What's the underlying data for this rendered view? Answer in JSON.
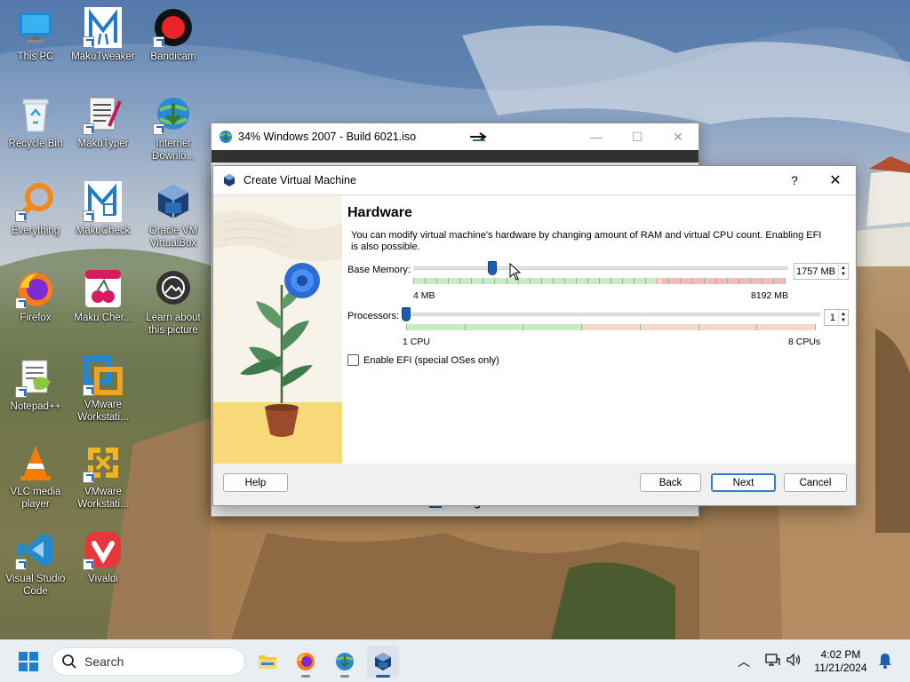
{
  "desktop": {
    "icons": [
      {
        "label": "This PC"
      },
      {
        "label": "MakuTweaker"
      },
      {
        "label": "Bandicam"
      },
      {
        "label": "Recycle Bin"
      },
      {
        "label": "MakuTyper"
      },
      {
        "label": "Internet Downlo..."
      },
      {
        "label": "Everything"
      },
      {
        "label": "MakuCheck"
      },
      {
        "label": "Oracle VM VirtualBox"
      },
      {
        "label": "Firefox"
      },
      {
        "label": "Maku.Cher..."
      },
      {
        "label": "Learn about this picture"
      },
      {
        "label": "Notepad++"
      },
      {
        "label": "VMware Workstati..."
      },
      {
        "label": "VLC media player"
      },
      {
        "label": "VMware Workstati..."
      },
      {
        "label": "Visual Studio Code"
      },
      {
        "label": "Vivaldi"
      }
    ]
  },
  "background_window": {
    "title": "34% Windows 2007 - Build 6021.iso",
    "minimize": "—",
    "maximize": "☐",
    "close": "✕",
    "storage_label": "Storage"
  },
  "dialog": {
    "title": "Create Virtual Machine",
    "help_glyph": "?",
    "close_glyph": "✕",
    "heading": "Hardware",
    "description": "You can modify virtual machine's hardware by changing amount of RAM and virtual CPU count. Enabling EFI is also possible.",
    "memory": {
      "label": "Base Memory:",
      "value": "1757 MB",
      "value_mb": 1757,
      "min_mb": 4,
      "max_mb": 8192,
      "min_label": "4 MB",
      "max_label": "8192 MB"
    },
    "processors": {
      "label": "Processors:",
      "value": "1",
      "value_num": 1,
      "min_num": 1,
      "max_num": 8,
      "min_label": "1 CPU",
      "max_label": "8 CPUs"
    },
    "efi": {
      "label": "Enable EFI (special OSes only)",
      "checked": false
    },
    "buttons": {
      "help": "Help",
      "back": "Back",
      "next": "Next",
      "cancel": "Cancel"
    }
  },
  "taskbar": {
    "search_placeholder": "Search",
    "apps": [
      "file-explorer",
      "firefox",
      "internet-download-manager",
      "virtualbox"
    ],
    "active_app": "virtualbox",
    "time": "4:02 PM",
    "date": "11/21/2024"
  },
  "colors": {
    "accent": "#1a5fb4",
    "slider_green": "#c8ecc4",
    "slider_red": "#f3bcbc",
    "taskbar": "#e9eef3"
  }
}
